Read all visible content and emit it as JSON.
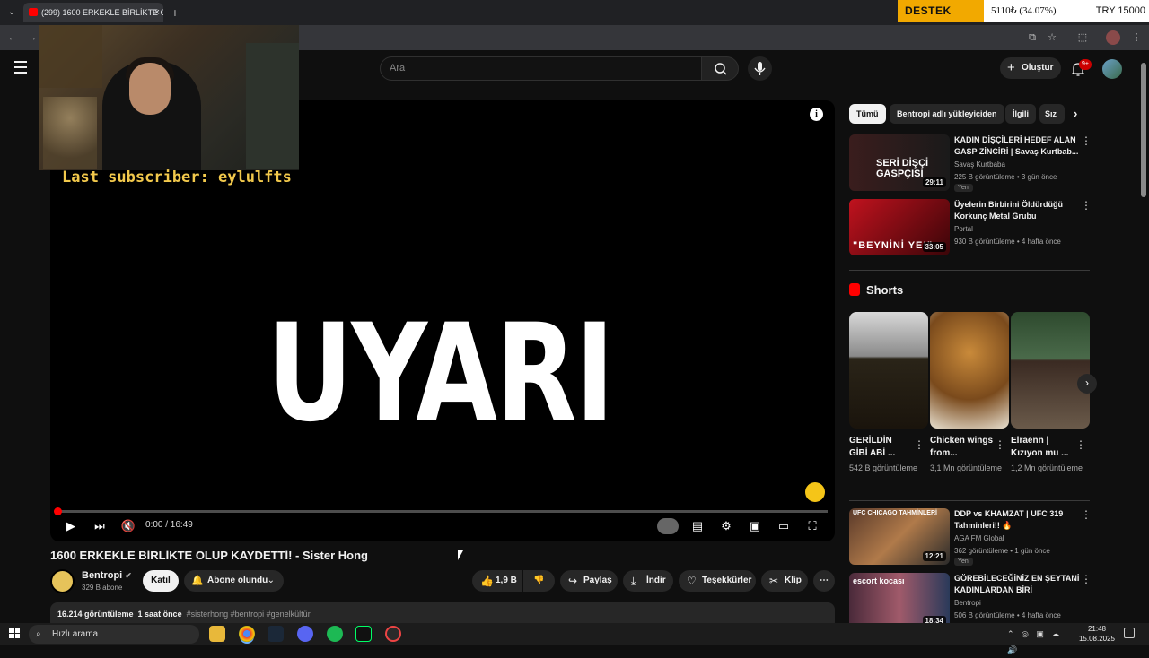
{
  "browser": {
    "tab_title": "(299) 1600 ERKEKLE BİRLİKTE O",
    "new_tab": "+",
    "tab_menu": "⌄"
  },
  "ticker": {
    "label": "DESTEK",
    "value": "5110₺ (34.07%)",
    "currency": "TRY 15000"
  },
  "overlay": {
    "last_subscriber": "Last subscriber: eylulfts"
  },
  "header": {
    "search_placeholder": "Ara",
    "create_label": "Oluştur",
    "notifications_count": "9+"
  },
  "player": {
    "center_text": "UYARI",
    "time": "0:00 / 16:49",
    "progress": 0.0
  },
  "video": {
    "title": "1600 ERKEKLE BİRLİKTE OLUP KAYDETTİ! - Sister Hong",
    "channel": "Bentropi",
    "subscribers": "329 B abone",
    "join_label": "Katıl",
    "subscribed_label": "Abone olundu",
    "likes": "1,9 B",
    "share_label": "Paylaş",
    "download_label": "İndir",
    "thanks_label": "Teşekkürler",
    "clip_label": "Klip",
    "views": "16.214 görüntüleme",
    "age": "1 saat önce",
    "hashtags": "#sisterhong #bentropi #genelkültür"
  },
  "chips": [
    "Tümü",
    "Bentropi adlı yükleyiciden",
    "İlgili",
    "Sız"
  ],
  "recommendations": [
    {
      "title": "KADIN DİŞÇİLERİ HEDEF ALAN GASP ZİNCİRİ | Savaş Kurtbab...",
      "channel": "Savaş Kurtbaba",
      "meta": "225 B görüntüleme • 3 gün önce",
      "badge": "Yeni",
      "duration": "29:11",
      "thumb_text": "SERİ DİŞÇİ GASPÇISI"
    },
    {
      "title": "Üyelerin Birbirini Öldürdüğü Korkunç Metal Grubu",
      "channel": "Portal",
      "meta": "930 B görüntüleme • 4 hafta önce",
      "badge": "",
      "duration": "33:05",
      "thumb_text": "\"BEYNİNİ YE!\""
    }
  ],
  "shorts": {
    "heading": "Shorts",
    "items": [
      {
        "title": "GERİLDİN GİBİ ABİ ...",
        "views": "542 B görüntüleme"
      },
      {
        "title": "Chicken wings from...",
        "views": "3,1 Mn görüntüleme"
      },
      {
        "title": "Elraenn | Kızıyon mu ...",
        "views": "1,2 Mn görüntüleme"
      }
    ]
  },
  "recommendations2": [
    {
      "title": "DDP vs KHAMZAT | UFC 319 Tahminleri!! 🔥",
      "channel": "AGA FM Global",
      "meta": "362 görüntüleme • 1 gün önce",
      "badge": "Yeni",
      "duration": "12:21",
      "thumb_text": "UFC CHICAGO TAHMİNLERİ"
    },
    {
      "title": "GÖREBİLECEĞİNİZ EN ŞEYTANİ KADINLARDAN BİRİ",
      "channel": "Bentropi",
      "meta": "506 B görüntüleme • 4 hafta önce",
      "badge": "",
      "duration": "18:34",
      "thumb_text": "escort kocası"
    }
  ],
  "taskbar": {
    "search_label": "Hızlı arama",
    "time": "21:48",
    "date": "15.08.2025"
  },
  "colors": {
    "accent": "#ff0000",
    "ticker_bg": "#f2a900",
    "overlay_text": "#f2c94c"
  }
}
